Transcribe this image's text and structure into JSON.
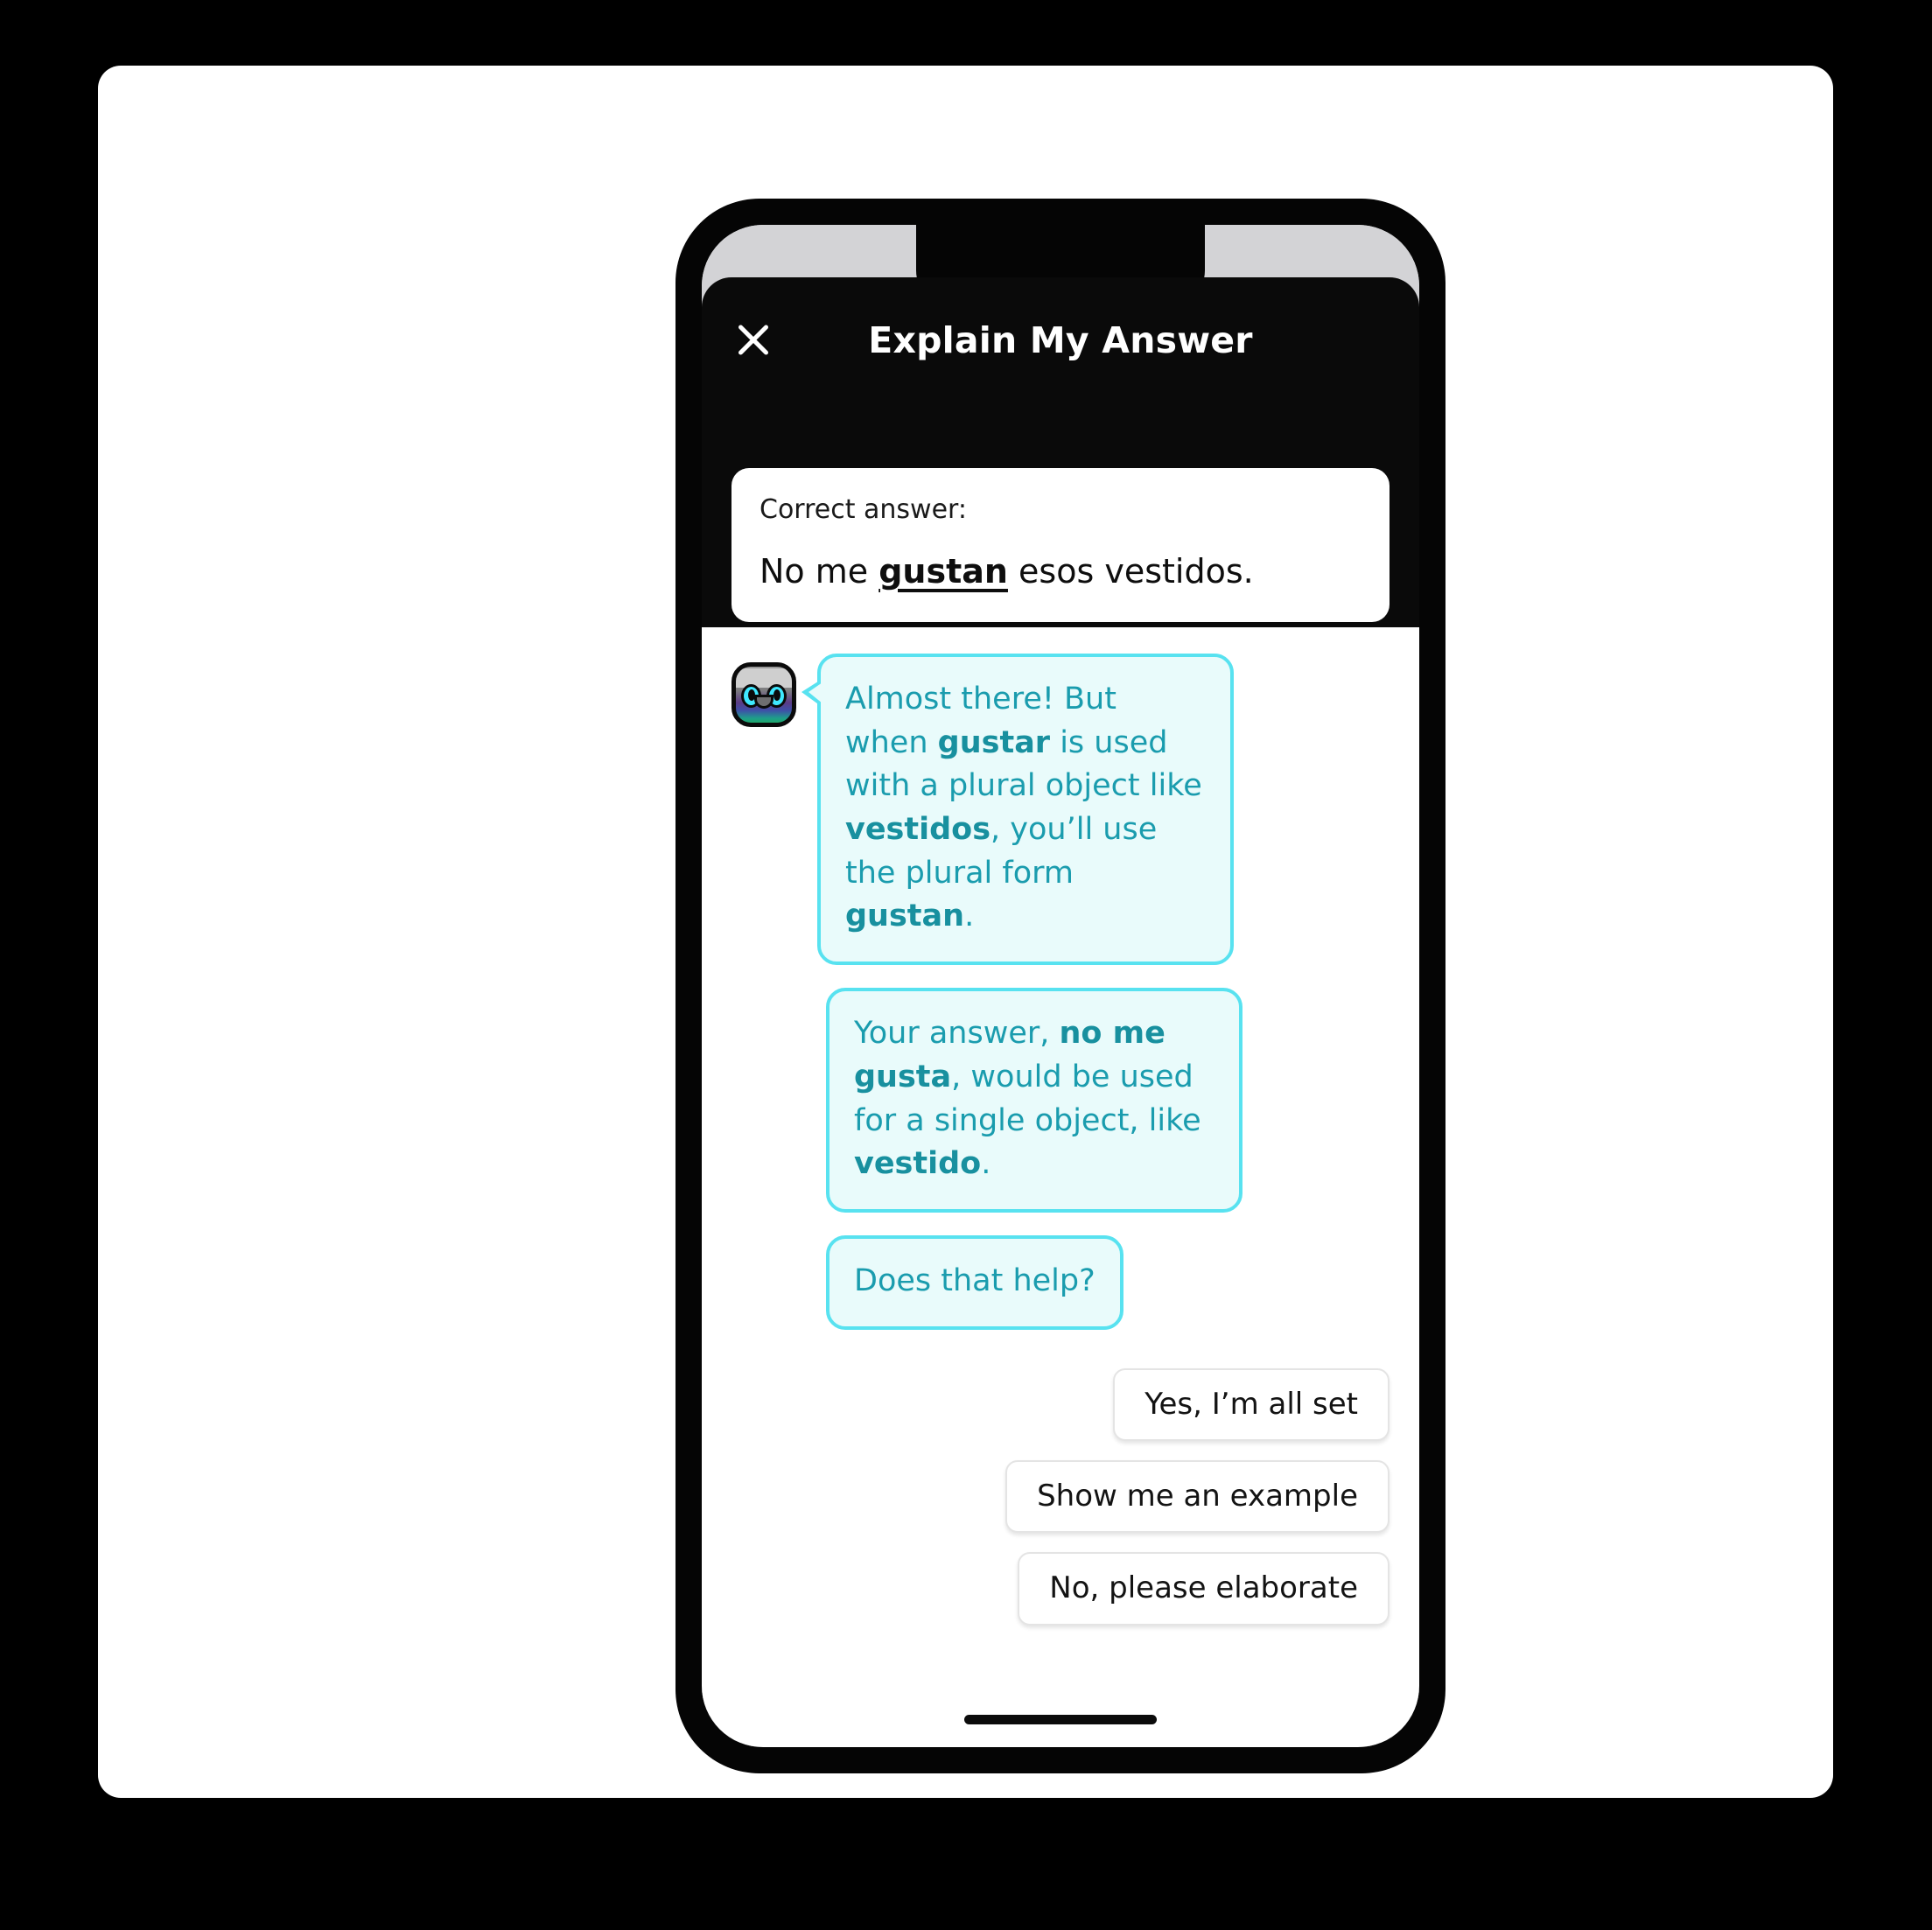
{
  "modal": {
    "title": "Explain My Answer",
    "close_icon": "close-icon"
  },
  "answer_card": {
    "label": "Correct answer:",
    "sentence_before": "No me ",
    "sentence_highlight": "gustan",
    "sentence_after": " esos vestidos."
  },
  "chat": {
    "avatar_name": "owl-mascot-avatar",
    "messages": [
      {
        "id": "bubble-1",
        "parts": [
          {
            "text": "Almost there! But when ",
            "bold": false
          },
          {
            "text": "gustar",
            "bold": true
          },
          {
            "text": " is used with a plural object like ",
            "bold": false
          },
          {
            "text": "vestidos",
            "bold": true
          },
          {
            "text": ", you’ll use the plural form ",
            "bold": false
          },
          {
            "text": "gustan",
            "bold": true
          },
          {
            "text": ".",
            "bold": false
          }
        ]
      },
      {
        "id": "bubble-2",
        "parts": [
          {
            "text": "Your answer, ",
            "bold": false
          },
          {
            "text": "no me gusta",
            "bold": true
          },
          {
            "text": ", would be used for a single object, like ",
            "bold": false
          },
          {
            "text": "vestido",
            "bold": true
          },
          {
            "text": ".",
            "bold": false
          }
        ]
      },
      {
        "id": "bubble-3",
        "parts": [
          {
            "text": "Does that help?",
            "bold": false
          }
        ]
      }
    ]
  },
  "replies": [
    {
      "id": "reply-yes-all-set",
      "label": "Yes, I’m all set"
    },
    {
      "id": "reply-show-example",
      "label": "Show me an example"
    },
    {
      "id": "reply-elaborate",
      "label": "No, please elaborate"
    }
  ],
  "colors": {
    "bubble_fill": "#E9FBFB",
    "bubble_border": "#58E2F0",
    "bubble_text": "#1A9CAE",
    "modal_background": "#0A0A0A",
    "card_background": "#FFFFFF",
    "status_bar": "#D3D3D6",
    "bg_dot_1": "#2EC9AE",
    "bg_dot_2": "#22B573"
  }
}
